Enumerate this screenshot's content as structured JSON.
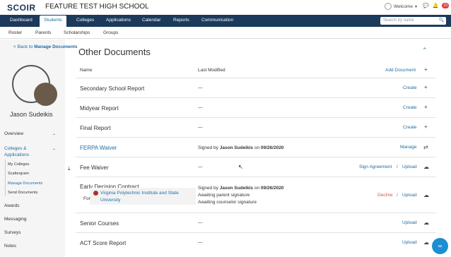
{
  "header": {
    "logo": "SCOIR",
    "school": "FEATURE TEST HIGH SCHOOL",
    "welcome": "Welcome",
    "notif_count": "23"
  },
  "nav": {
    "items": [
      "Dashboard",
      "Students",
      "Colleges",
      "Applications",
      "Calendar",
      "Reports",
      "Communication"
    ],
    "search_placeholder": "Search by name"
  },
  "subnav": {
    "items": [
      "Roster",
      "Parents",
      "Scholarships",
      "Groups"
    ]
  },
  "sidebar": {
    "back_prefix": "< Back to ",
    "back_bold": "Manage Documents",
    "student_name": "Jason Sudeikis",
    "overview": "Overview",
    "colleges_apps": "Colleges & Applications",
    "sub_items": [
      "My Colleges",
      "Scattergram",
      "Manage Documents",
      "Send Documents"
    ],
    "awards": "Awards",
    "messaging": "Messaging",
    "surveys": "Surveys",
    "notes": "Notes"
  },
  "main": {
    "title": "Other Documents",
    "col_name": "Name",
    "col_modified": "Last Modified",
    "add_document": "Add Document",
    "rows": [
      {
        "name": "Secondary School Report",
        "modified": "—",
        "action": "Create"
      },
      {
        "name": "Midyear Report",
        "modified": "—",
        "action": "Create"
      },
      {
        "name": "Final Report",
        "modified": "—",
        "action": "Create"
      },
      {
        "name": "FERPA Waiver",
        "signed_prefix": "Signed by ",
        "signed_by": "Jason Sudeikis",
        "on": " on ",
        "date": "09/26/2020",
        "action": "Manage"
      },
      {
        "name": "Fee Waiver",
        "modified": "—",
        "action": "Sign Agreement",
        "sep": "/",
        "action2": "Upload"
      },
      {
        "name": "Early Decision Contract",
        "signed_prefix": "Signed by ",
        "signed_by": "Jason Sudeikis",
        "on": " on ",
        "date": "09/26/2020",
        "line2": "Awaiting parent signature",
        "line3": "Awaiting counselor signature",
        "action": "Decline",
        "sep": "/",
        "action2": "Upload",
        "for_label": "For",
        "college": "Virginia Polytechnic Institute and State University"
      },
      {
        "name": "Senior Courses",
        "modified": "—",
        "action": "Upload"
      },
      {
        "name": "ACT Score Report",
        "modified": "—",
        "action": "Upload"
      }
    ]
  }
}
